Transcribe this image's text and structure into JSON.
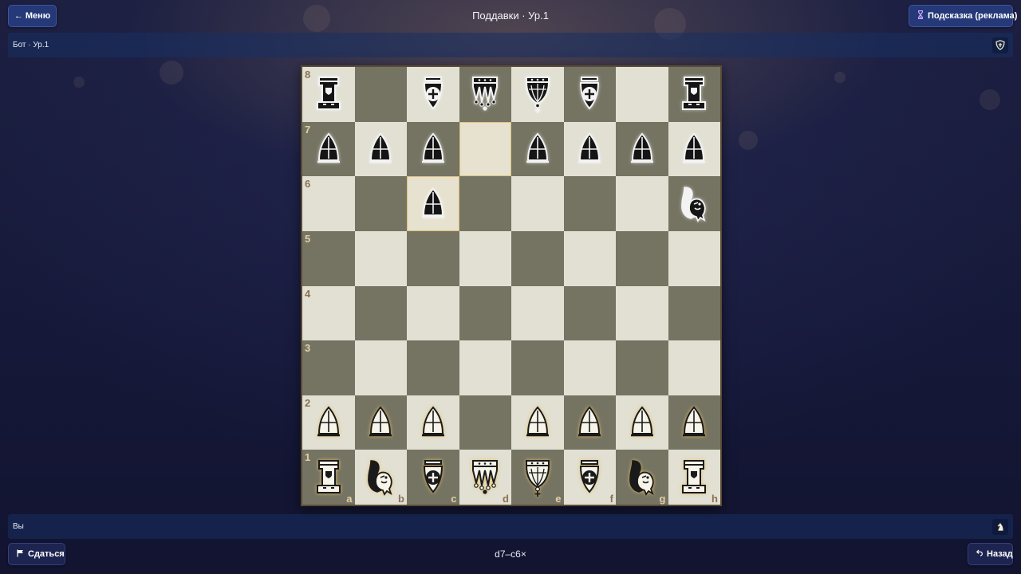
{
  "header": {
    "menu_label": "← Меню",
    "title": "Поддавки · Ур.1",
    "hint_label": "Подсказка (реклама)",
    "hint_icon": "hourglass-icon"
  },
  "opponent": {
    "label": "Бот · Ур.1",
    "icon": "shield-icon"
  },
  "player": {
    "label": "Вы",
    "icon": "knight-icon"
  },
  "board": {
    "orientation": "white-bottom",
    "ranks": [
      "8",
      "7",
      "6",
      "5",
      "4",
      "3",
      "2",
      "1"
    ],
    "files": [
      "a",
      "b",
      "c",
      "d",
      "e",
      "f",
      "g",
      "h"
    ],
    "rows": [
      [
        "bR",
        "",
        "bB",
        "bQ",
        "bK",
        "bB",
        "",
        "bR"
      ],
      [
        "bP",
        "bP",
        "bP",
        "",
        "bP",
        "bP",
        "bP",
        "bP"
      ],
      [
        "",
        "",
        "bP",
        "",
        "",
        "",
        "",
        "bN"
      ],
      [
        "",
        "",
        "",
        "",
        "",
        "",
        "",
        ""
      ],
      [
        "",
        "",
        "",
        "",
        "",
        "",
        "",
        ""
      ],
      [
        "",
        "",
        "",
        "",
        "",
        "",
        "",
        ""
      ],
      [
        "wP",
        "wP",
        "wP",
        "",
        "wP",
        "wP",
        "wP",
        "wP"
      ],
      [
        "wR",
        "wN",
        "wB",
        "wQ",
        "wK",
        "wB",
        "wN",
        "wR"
      ]
    ],
    "highlighted": [
      "d7",
      "c6"
    ],
    "colors": {
      "light": "#e1e0d3",
      "dark": "#757463",
      "highlight": "#e0c07a"
    }
  },
  "footer": {
    "resign_label": "Сдаться",
    "resign_icon": "flag-icon",
    "last_move": "d7–c6×",
    "undo_label": "Назад",
    "undo_icon": "undo-icon"
  },
  "colors": {
    "button": "#253878",
    "bar": "#183062",
    "background": "#151838"
  }
}
